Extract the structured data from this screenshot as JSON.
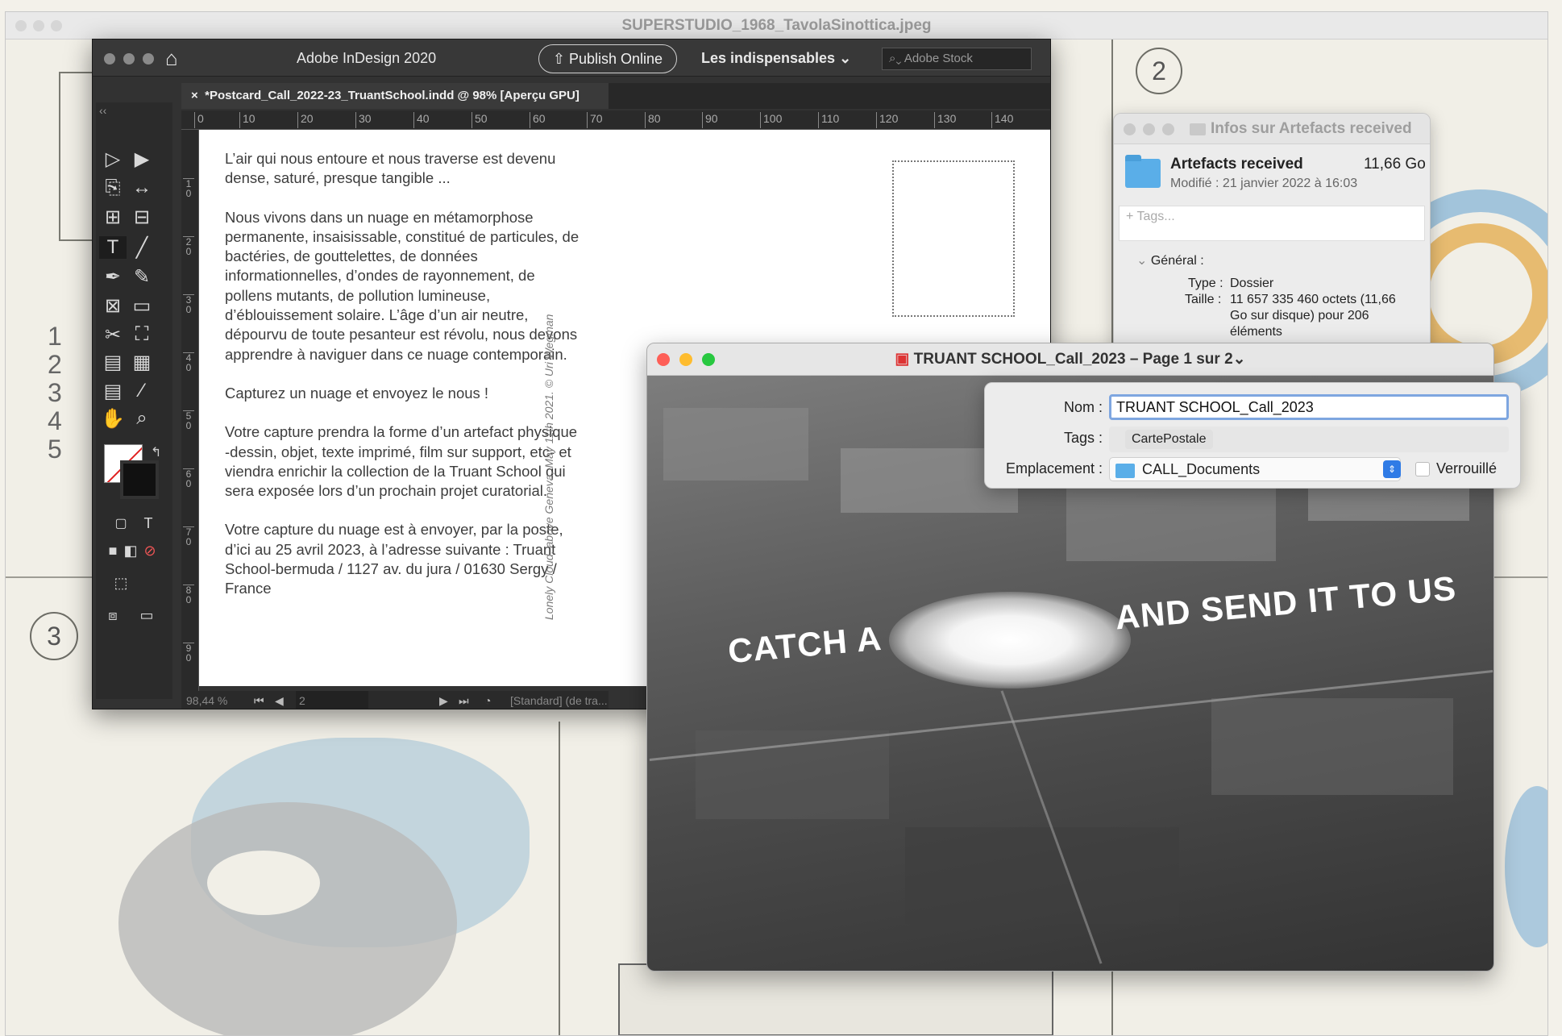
{
  "background_window": {
    "title": "SUPERSTUDIO_1968_TavolaSinottica.jpeg",
    "circle_labels": [
      "2",
      "3"
    ],
    "handwritten_numbers": [
      "1",
      "2",
      "3",
      "4",
      "5"
    ]
  },
  "indesign": {
    "app_title": "Adobe InDesign 2020",
    "publish_label": "Publish Online",
    "workspace_label": "Les indispensables",
    "search_placeholder": "Adobe Stock",
    "doc_tab": "*Postcard_Call_2022-23_TruantSchool.indd @ 98% [Aperçu GPU]",
    "ruler_h": [
      "0",
      "10",
      "20",
      "30",
      "40",
      "50",
      "60",
      "70",
      "80",
      "90",
      "100",
      "110",
      "120",
      "130",
      "140"
    ],
    "ruler_v": [
      "1\n0",
      "2\n0",
      "3\n0",
      "4\n0",
      "5\n0",
      "6\n0",
      "7\n0",
      "8\n0",
      "9\n0"
    ],
    "page_paragraphs": [
      "L’air qui nous entoure et nous traverse est devenu dense, saturé, presque tangible ...",
      "Nous vivons dans un nuage en métamorphose permanente, insaisissable, constitué de particules, de bactéries, de gouttelettes, de données informationnelles, d’ondes de rayonnement, de pollens mutants, de pollution lumineuse, d’éblouissement solaire. L’âge d’un air neutre, dépourvu de toute pesanteur est révolu, nous devons apprendre à naviguer dans ce nuage contemporain.",
      "Capturez un nuage et envoyez le nous !",
      "Votre capture prendra la forme d’un artefact physique -dessin, objet, texte imprimé, film sur support, etc- et viendra enrichir la collection de la Truant School qui sera exposée lors d’un prochain projet curatorial.",
      "Votre capture du nuage est à envoyer, par la poste, d’ici au 25 avril 2023, à l’adresse suivante : Truant School-bermuda / 1127 av. du jura / 01630 Sergy / France"
    ],
    "photo_credit": "Lonely Cloud, above Geneva, May 11th 2021. © Uri Wegman",
    "status": {
      "zoom": "98,44 %",
      "page": "2",
      "style": "[Standard] (de tra..."
    }
  },
  "info_window": {
    "title": "Infos sur Artefacts received",
    "name": "Artefacts received",
    "size": "11,66 Go",
    "modified": "Modifié : 21 janvier 2022 à 16:03",
    "tags_placeholder": "+ Tags...",
    "section": "Général :",
    "type_label": "Type :",
    "type_value": "Dossier",
    "size_label": "Taille :",
    "size_value_1": "11 657 335 460 octets (11,66",
    "size_value_2": "Go sur disque) pour 206",
    "size_value_3": "éléments"
  },
  "pdf_window": {
    "title": "TRUANT SCHOOL_Call_2023 – Page 1 sur 2",
    "chevron": "⌄",
    "photo_text_left": "CATCH A",
    "photo_text_right": "AND SEND IT TO US"
  },
  "rename_popover": {
    "name_label": "Nom :",
    "name_value": "TRUANT SCHOOL_Call_2023",
    "tags_label": "Tags :",
    "tag": "CartePostale",
    "location_label": "Emplacement :",
    "location_value": "CALL_Documents",
    "locked_label": "Verrouillé"
  },
  "colors": {
    "indesign_bg": "#323232",
    "accent_blue": "#2f7be6",
    "folder_blue": "#5aaee8",
    "close_red": "#fe5f57",
    "min_yellow": "#febc2e",
    "max_green": "#28c840"
  }
}
